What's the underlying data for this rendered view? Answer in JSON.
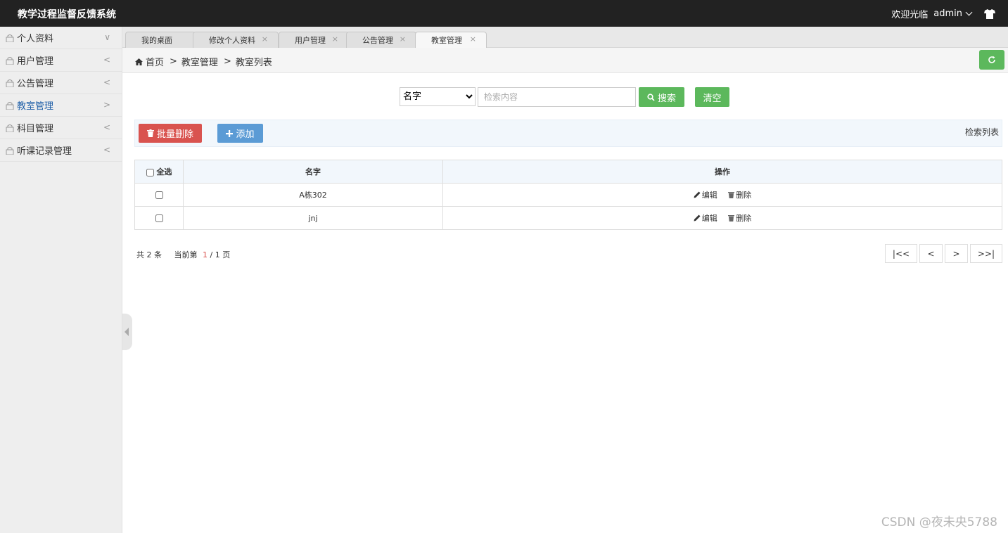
{
  "app": {
    "title": "教学过程监督反馈系统"
  },
  "topbar": {
    "welcome": "欢迎光临",
    "username": "admin"
  },
  "sidebar": {
    "items": [
      {
        "label": "个人资料",
        "arrow": "∨"
      },
      {
        "label": "用户管理",
        "arrow": "<"
      },
      {
        "label": "公告管理",
        "arrow": "<"
      },
      {
        "label": "教室管理",
        "arrow": ">"
      },
      {
        "label": "科目管理",
        "arrow": "<"
      },
      {
        "label": "听课记录管理",
        "arrow": "<"
      }
    ]
  },
  "tabs": [
    {
      "label": "我的桌面"
    },
    {
      "label": "修改个人资料"
    },
    {
      "label": "用户管理"
    },
    {
      "label": "公告管理"
    },
    {
      "label": "教室管理"
    }
  ],
  "breadcrumb": {
    "home": "首页",
    "parent": "教室管理",
    "current": "教室列表",
    "sep": ">"
  },
  "search": {
    "field_selected": "名字",
    "placeholder": "检索内容",
    "search_label": "搜索",
    "clear_label": "清空"
  },
  "actions": {
    "batch_delete": "批量删除",
    "add": "添加",
    "list_title": "检索列表"
  },
  "table": {
    "select_all": "全选",
    "columns": [
      "名字",
      "操作"
    ],
    "rows": [
      {
        "name": "A栋302"
      },
      {
        "name": "jnj"
      }
    ],
    "edit_label": "编辑",
    "delete_label": "删除"
  },
  "pagination": {
    "total_prefix": "共",
    "total": "2",
    "total_suffix": "条",
    "current_prefix": "当前第",
    "current": "1",
    "slash": "/",
    "pages": "1",
    "pages_suffix": "页",
    "first": "|<<",
    "prev": "<",
    "next": ">",
    "last": ">>|"
  },
  "watermark": "CSDN @夜未央5788",
  "colors": {
    "topbar": "#222222",
    "green": "#5cb85c",
    "red": "#d9534f",
    "blue": "#5b9bd5",
    "active_nav": "#1f5fa8"
  }
}
